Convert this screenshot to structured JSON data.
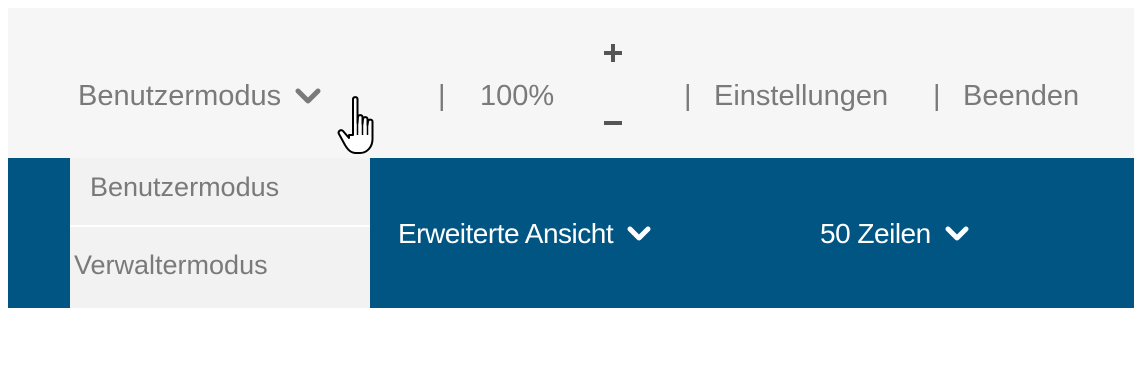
{
  "topbar": {
    "mode_label": "Benutzermodus",
    "separator": "|",
    "zoom_level": "100%",
    "zoom_in_icon": "plus-icon",
    "zoom_out_icon": "minus-icon",
    "settings_label": "Einstellungen",
    "quit_label": "Beenden"
  },
  "mode_dropdown": {
    "options": [
      {
        "label": "Benutzermodus"
      },
      {
        "label": "Verwaltermodus"
      }
    ]
  },
  "navbar": {
    "view_label": "Erweiterte Ansicht",
    "rows_label": "50 Zeilen"
  },
  "colors": {
    "navbar_bg": "#005583",
    "topbar_bg": "#f6f6f6",
    "dropdown_bg": "#f2f2f2",
    "muted_text": "#7a7a7a"
  }
}
